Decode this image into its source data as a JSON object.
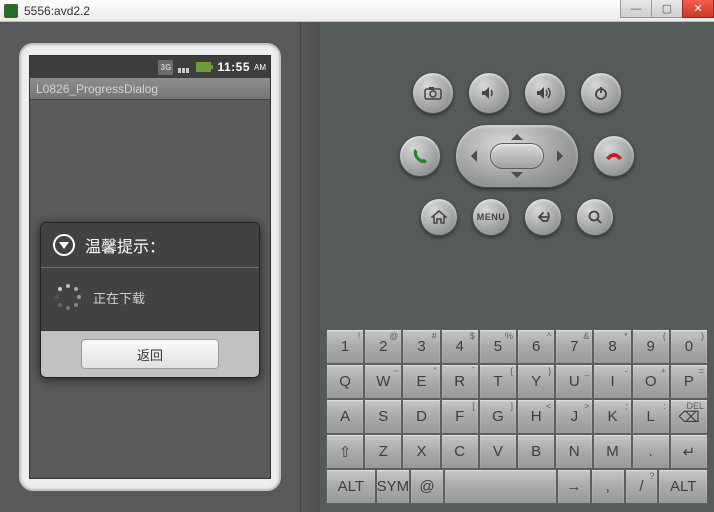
{
  "window": {
    "title": "5556:avd2.2"
  },
  "status_bar": {
    "network": "3G",
    "clock": "11:55",
    "ampm": "AM"
  },
  "app": {
    "title": "L0826_ProgressDialog"
  },
  "dialog": {
    "title": "温馨提示：",
    "message": "正在下载",
    "button": "返回"
  },
  "hw": {
    "menu_label": "MENU"
  },
  "keyboard": {
    "row1": [
      {
        "m": "1",
        "s": "!"
      },
      {
        "m": "2",
        "s": "@"
      },
      {
        "m": "3",
        "s": "#"
      },
      {
        "m": "4",
        "s": "$"
      },
      {
        "m": "5",
        "s": "%"
      },
      {
        "m": "6",
        "s": "^"
      },
      {
        "m": "7",
        "s": "&"
      },
      {
        "m": "8",
        "s": "*"
      },
      {
        "m": "9",
        "s": "("
      },
      {
        "m": "0",
        "s": ")"
      }
    ],
    "row2": [
      {
        "m": "Q",
        "s": ""
      },
      {
        "m": "W",
        "s": "~"
      },
      {
        "m": "E",
        "s": "\""
      },
      {
        "m": "R",
        "s": "`"
      },
      {
        "m": "T",
        "s": "{"
      },
      {
        "m": "Y",
        "s": "}"
      },
      {
        "m": "U",
        "s": "_"
      },
      {
        "m": "I",
        "s": "-"
      },
      {
        "m": "O",
        "s": "+"
      },
      {
        "m": "P",
        "s": "="
      }
    ],
    "row3": [
      {
        "m": "A",
        "s": ""
      },
      {
        "m": "S",
        "s": ""
      },
      {
        "m": "D",
        "s": ""
      },
      {
        "m": "F",
        "s": "["
      },
      {
        "m": "G",
        "s": "]"
      },
      {
        "m": "H",
        "s": "<"
      },
      {
        "m": "J",
        "s": ">"
      },
      {
        "m": "K",
        "s": ";"
      },
      {
        "m": "L",
        "s": ":"
      },
      {
        "m": "DEL",
        "s": "",
        "del": true
      }
    ],
    "row4": [
      {
        "m": "⇧",
        "s": ""
      },
      {
        "m": "Z",
        "s": ""
      },
      {
        "m": "X",
        "s": ""
      },
      {
        "m": "C",
        "s": ""
      },
      {
        "m": "V",
        "s": ""
      },
      {
        "m": "B",
        "s": ""
      },
      {
        "m": "N",
        "s": ""
      },
      {
        "m": "M",
        "s": ""
      },
      {
        "m": ".",
        "s": ""
      },
      {
        "m": "↵",
        "s": ""
      }
    ],
    "row5": [
      {
        "m": "ALT",
        "s": "",
        "wide": true
      },
      {
        "m": "SYM",
        "s": ""
      },
      {
        "m": "@",
        "s": ""
      },
      {
        "m": "",
        "s": "",
        "space": true
      },
      {
        "m": "→",
        "s": "",
        "arrow": true
      },
      {
        "m": ",",
        "s": ""
      },
      {
        "m": "/",
        "s": "?"
      },
      {
        "m": "ALT",
        "s": "",
        "wide": true
      }
    ]
  }
}
